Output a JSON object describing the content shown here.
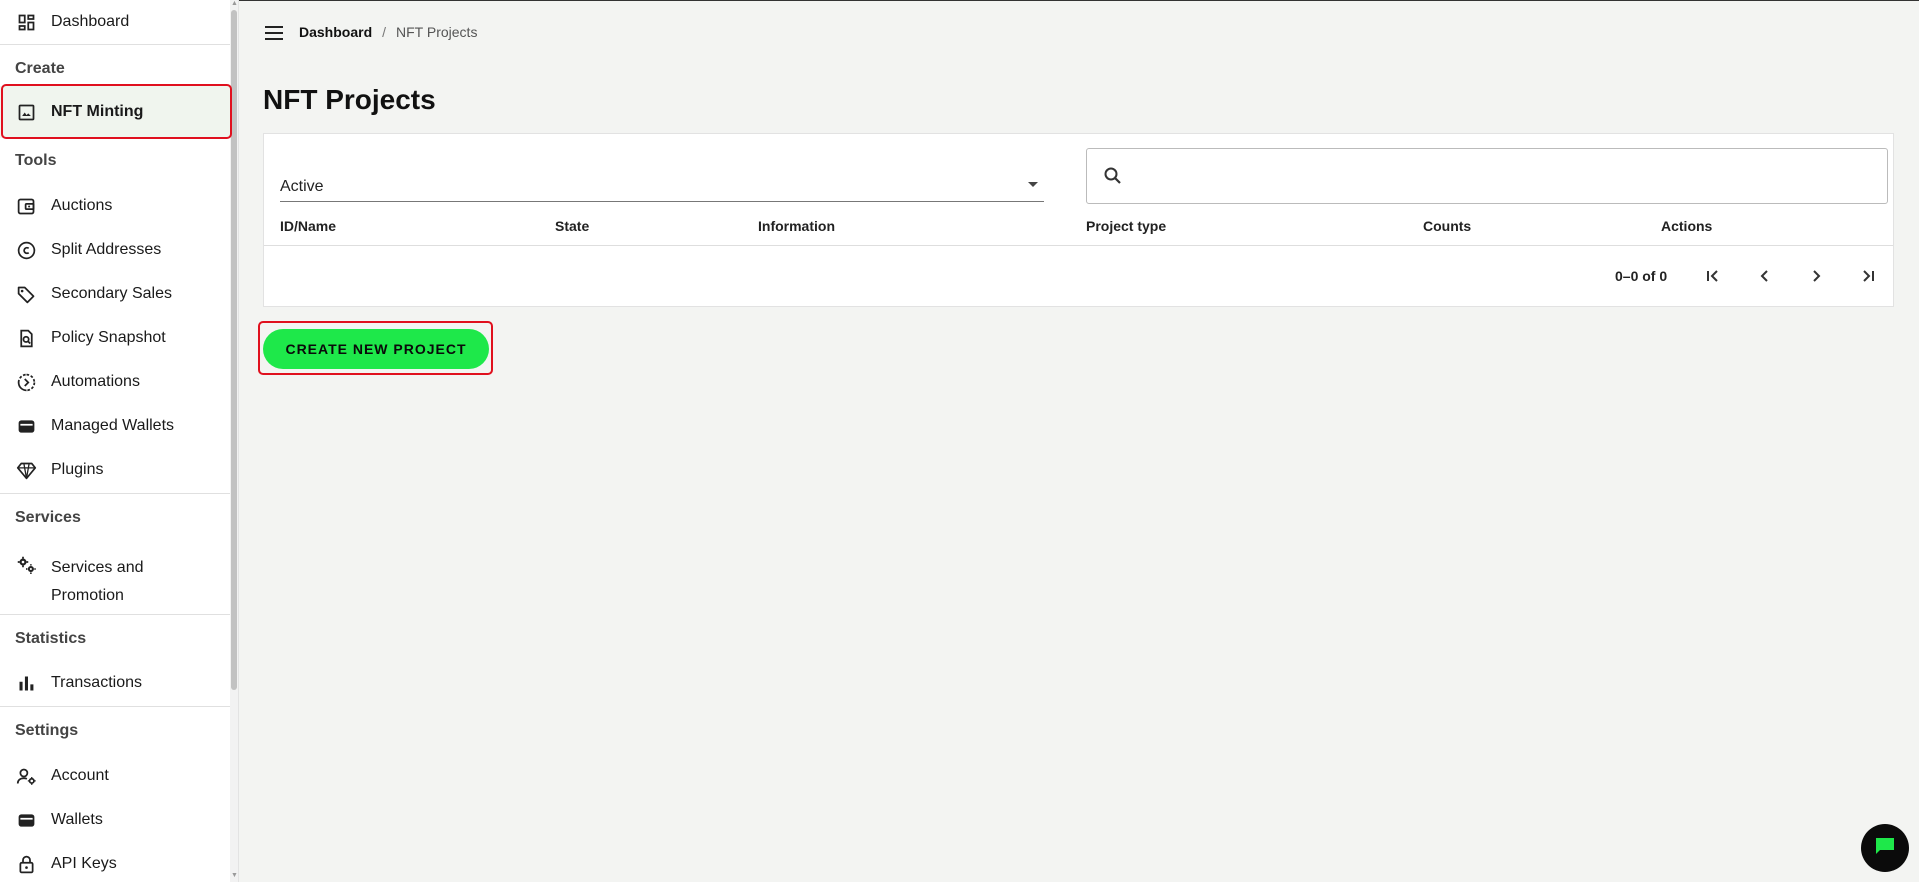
{
  "sidebar": {
    "items": [
      {
        "label": "Dashboard",
        "icon": "dashboard-icon"
      },
      {
        "label": "NFT Minting",
        "icon": "image-icon"
      },
      {
        "label": "Auctions",
        "icon": "auction-icon"
      },
      {
        "label": "Split Addresses",
        "icon": "copyright-icon"
      },
      {
        "label": "Secondary Sales",
        "icon": "tag-icon"
      },
      {
        "label": "Policy Snapshot",
        "icon": "file-search-icon"
      },
      {
        "label": "Automations",
        "icon": "automation-icon"
      },
      {
        "label": "Managed Wallets",
        "icon": "wallet-icon"
      },
      {
        "label": "Plugins",
        "icon": "gem-icon"
      },
      {
        "label": "Services and",
        "label2": "Promotion",
        "icon": "gears-icon"
      },
      {
        "label": "Transactions",
        "icon": "bar-chart-icon"
      },
      {
        "label": "Account",
        "icon": "user-settings-icon"
      },
      {
        "label": "Wallets",
        "icon": "wallet-icon"
      },
      {
        "label": "API Keys",
        "icon": "lock-icon"
      }
    ],
    "sections": {
      "create": "Create",
      "tools": "Tools",
      "services": "Services",
      "statistics": "Statistics",
      "settings": "Settings"
    }
  },
  "breadcrumb": {
    "home": "Dashboard",
    "separator": "/",
    "current": "NFT Projects"
  },
  "page": {
    "title": "NFT Projects"
  },
  "filter": {
    "state_value": "Active",
    "search_value": ""
  },
  "table": {
    "columns": [
      "ID/Name",
      "State",
      "Information",
      "Project type",
      "Counts",
      "Actions"
    ],
    "rows": []
  },
  "pagination": {
    "range": "0–0 of 0"
  },
  "actions": {
    "create_label": "CREATE NEW PROJECT"
  },
  "colors": {
    "accent": "#1ee84a",
    "highlight": "#e0101e",
    "active_bg": "#f0f5ee"
  }
}
